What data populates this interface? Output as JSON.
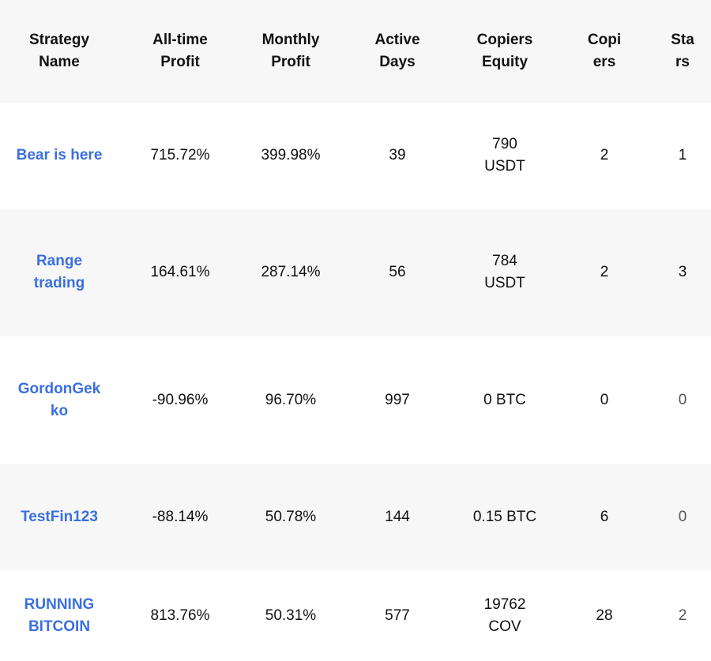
{
  "table": {
    "headers": {
      "strategy_name": "Strategy Name",
      "all_time_profit": "All-time Profit",
      "monthly_profit": "Monthly Profit",
      "active_days": "Active Days",
      "copiers_equity": "Copiers Equity",
      "copiers": "Copiers",
      "stars": "Stars"
    },
    "rows": [
      {
        "name": "Bear is here",
        "all_time_profit": "715.72%",
        "monthly_profit": "399.98%",
        "active_days": "39",
        "copiers_equity": "790 USDT",
        "copiers": "2",
        "stars": "1"
      },
      {
        "name": "Range trading",
        "all_time_profit": "164.61%",
        "monthly_profit": "287.14%",
        "active_days": "56",
        "copiers_equity": "784 USDT",
        "copiers": "2",
        "stars": "3"
      },
      {
        "name": "GordonGekko",
        "all_time_profit": "-90.96%",
        "monthly_profit": "96.70%",
        "active_days": "997",
        "copiers_equity": "0 BTC",
        "copiers": "0",
        "stars": "0"
      },
      {
        "name": "TestFin123",
        "all_time_profit": "-88.14%",
        "monthly_profit": "50.78%",
        "active_days": "144",
        "copiers_equity": "0.15 BTC",
        "copiers": "6",
        "stars": "0"
      },
      {
        "name": "RUNNING BITCOIN",
        "all_time_profit": "813.76%",
        "monthly_profit": "50.31%",
        "active_days": "577",
        "copiers_equity": "19762 COV",
        "copiers": "28",
        "stars": "2"
      }
    ]
  }
}
